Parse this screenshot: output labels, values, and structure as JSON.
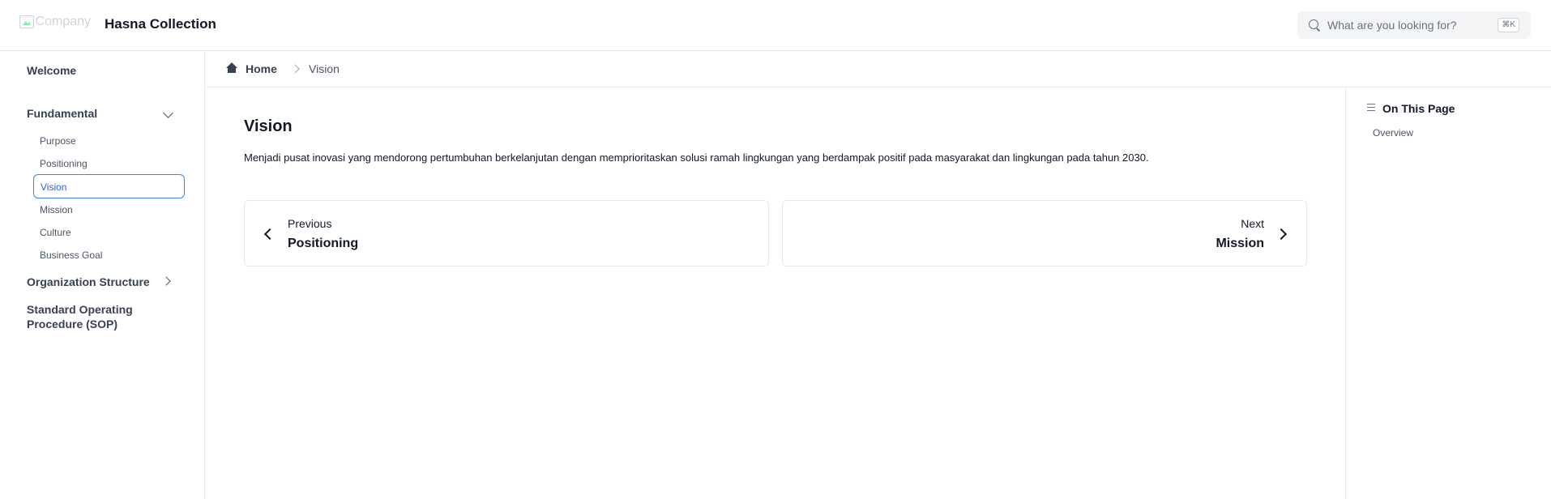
{
  "header": {
    "logo_alt": "Company",
    "brand": "Hasna Collection",
    "search": {
      "placeholder": "What are you looking for?",
      "shortcut": "⌘K"
    }
  },
  "sidebar": {
    "welcome": "Welcome",
    "fundamental": {
      "label": "Fundamental",
      "expanded": true,
      "items": [
        "Purpose",
        "Positioning",
        "Vision",
        "Mission",
        "Culture",
        "Business Goal"
      ],
      "active": "Vision"
    },
    "organization_structure": "Organization Structure",
    "sop_line1": "Standard Operating",
    "sop_line2": "Procedure (SOP)"
  },
  "breadcrumb": {
    "home": "Home",
    "current": "Vision"
  },
  "main": {
    "title": "Vision",
    "description": "Menjadi pusat inovasi yang mendorong pertumbuhan berkelanjutan dengan memprioritaskan solusi ramah lingkungan yang berdampak positif pada masyarakat dan lingkungan pada tahun 2030.",
    "prev": {
      "caption": "Previous",
      "title": "Positioning"
    },
    "next": {
      "caption": "Next",
      "title": "Mission"
    }
  },
  "toc": {
    "title": "On This Page",
    "items": [
      "Overview"
    ]
  },
  "colors": {
    "accent": "#3b82f6",
    "border": "#e5e7eb",
    "text": "#111827"
  }
}
